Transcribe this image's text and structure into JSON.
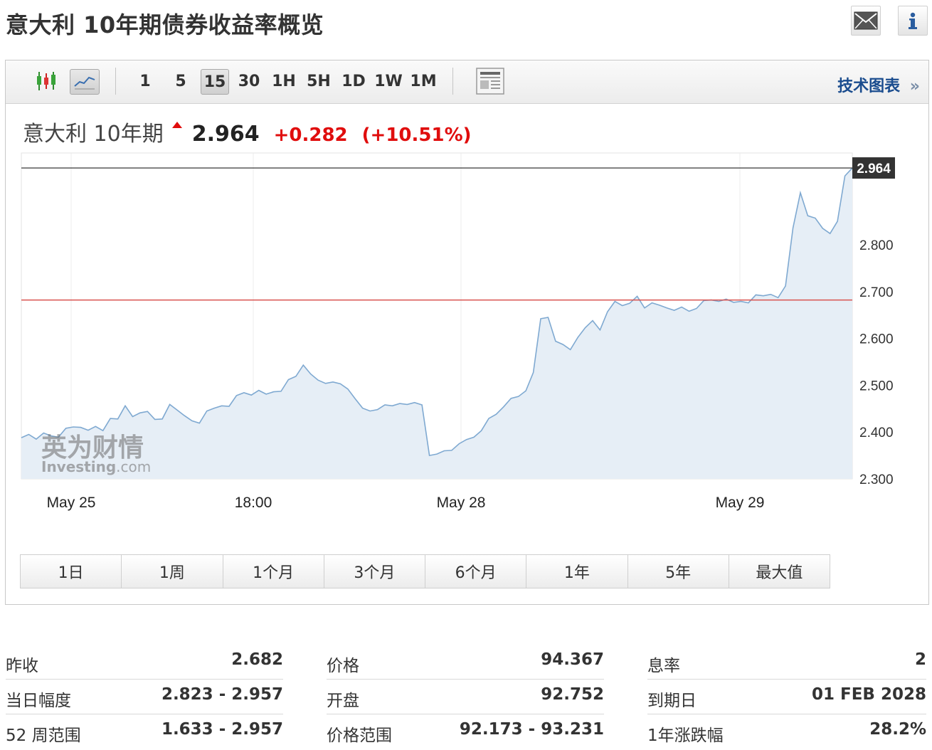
{
  "page_title": "意大利 10年期债券收益率概览",
  "header_icons": [
    "mail-icon",
    "info-icon"
  ],
  "toolbar": {
    "intervals": [
      "1",
      "5",
      "15",
      "30",
      "1H",
      "5H",
      "1D",
      "1W",
      "1M"
    ],
    "active_interval": "15",
    "tech_chart_link": "技术图表",
    "tech_chart_arrow": "»"
  },
  "quote": {
    "name": "意大利 10年期",
    "last": "2.964",
    "change": "+0.282",
    "change_pct": "(+10.51%)"
  },
  "watermark": {
    "cn": "英为财情",
    "en_main": "Investing",
    "en_suffix": ".com"
  },
  "chart_data": {
    "type": "area",
    "title": "",
    "x_labels": [
      "May 25",
      "18:00",
      "May 28",
      "May 29"
    ],
    "y_ticks": [
      2.3,
      2.4,
      2.5,
      2.6,
      2.7,
      2.8
    ],
    "y_tick_labels": [
      "2.300",
      "2.400",
      "2.500",
      "2.600",
      "2.700",
      "2.800"
    ],
    "ylim": [
      2.3,
      2.996
    ],
    "last_value": 2.964,
    "last_value_label": "2.964",
    "previous_close_line": 2.682,
    "grid": "vertical",
    "series": [
      {
        "values": [
          2.388,
          2.395,
          2.385,
          2.398,
          2.392,
          2.389,
          2.408,
          2.411,
          2.41,
          2.404,
          2.412,
          2.403,
          2.429,
          2.428,
          2.456,
          2.433,
          2.441,
          2.444,
          2.427,
          2.428,
          2.459,
          2.447,
          2.435,
          2.424,
          2.419,
          2.445,
          2.451,
          2.456,
          2.455,
          2.478,
          2.484,
          2.479,
          2.489,
          2.481,
          2.486,
          2.487,
          2.512,
          2.519,
          2.543,
          2.524,
          2.511,
          2.504,
          2.507,
          2.503,
          2.492,
          2.471,
          2.451,
          2.445,
          2.448,
          2.458,
          2.456,
          2.461,
          2.459,
          2.463,
          2.458,
          2.35,
          2.353,
          2.36,
          2.361,
          2.375,
          2.384,
          2.389,
          2.403,
          2.429,
          2.438,
          2.454,
          2.472,
          2.476,
          2.488,
          2.527,
          2.642,
          2.645,
          2.594,
          2.587,
          2.576,
          2.602,
          2.623,
          2.638,
          2.618,
          2.657,
          2.679,
          2.67,
          2.675,
          2.69,
          2.665,
          2.676,
          2.671,
          2.665,
          2.66,
          2.667,
          2.658,
          2.664,
          2.681,
          2.682,
          2.679,
          2.684,
          2.677,
          2.679,
          2.676,
          2.693,
          2.691,
          2.694,
          2.687,
          2.712,
          2.836,
          2.911,
          2.862,
          2.857,
          2.835,
          2.824,
          2.85,
          2.947,
          2.964
        ]
      }
    ]
  },
  "range_buttons": [
    "1日",
    "1周",
    "1个月",
    "3个月",
    "6个月",
    "1年",
    "5年",
    "最大值"
  ],
  "stats": {
    "col1": [
      {
        "label": "昨收",
        "value": "2.682"
      },
      {
        "label": "当日幅度",
        "value": "2.823 - 2.957"
      },
      {
        "label": "52 周范围",
        "value": "1.633 - 2.957"
      }
    ],
    "col2": [
      {
        "label": "价格",
        "value": "94.367"
      },
      {
        "label": "开盘",
        "value": "92.752"
      },
      {
        "label": "价格范围",
        "value": "92.173 - 93.231"
      }
    ],
    "col3": [
      {
        "label": "息率",
        "value": "2"
      },
      {
        "label": "到期日",
        "value": "01 FEB 2028"
      },
      {
        "label": "1年涨跌幅",
        "value": "28.2%"
      }
    ]
  },
  "colors": {
    "line": "#7fa9d1",
    "area": "#e6eef6",
    "prev_close": "#d9534f",
    "last_line": "#222222",
    "up": "#e00d0d",
    "link": "#1a4c8e"
  }
}
